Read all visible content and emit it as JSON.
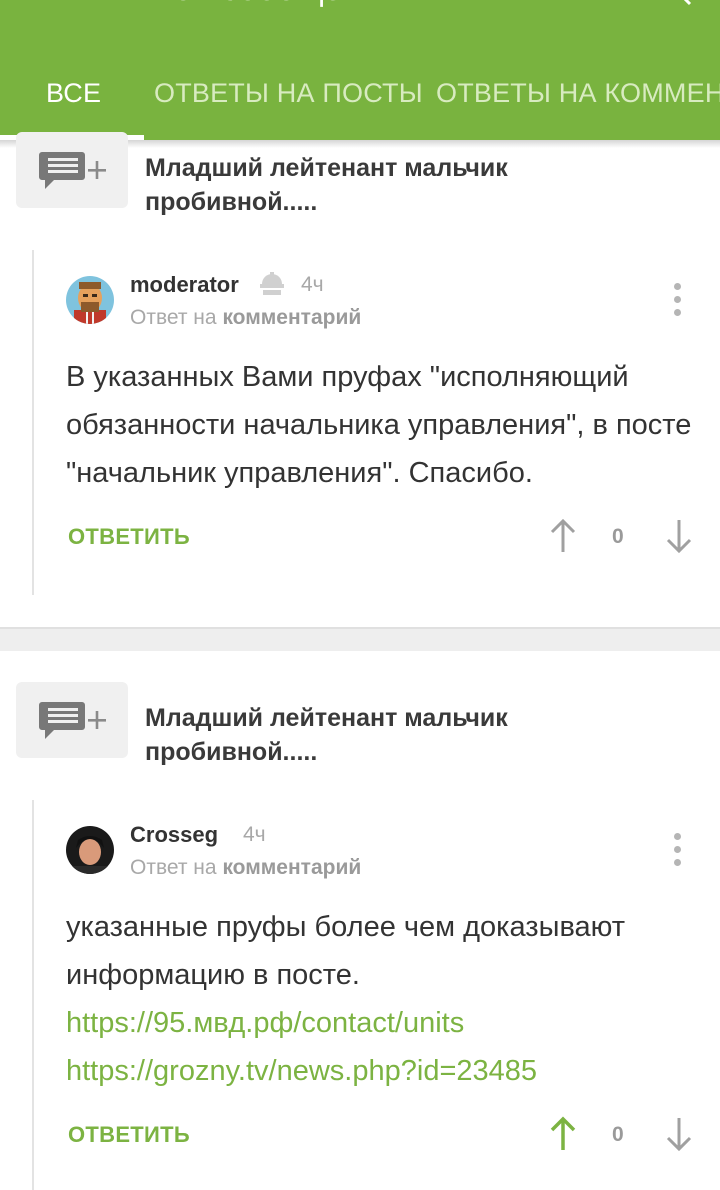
{
  "appbar": {
    "title": "Мои сообщения",
    "search_icon": "search-icon"
  },
  "tabs": [
    {
      "label": "ВСЕ",
      "active": true
    },
    {
      "label": "ОТВЕТЫ НА ПОСТЫ",
      "active": false
    },
    {
      "label": "ОТВЕТЫ НА КОММЕН",
      "active": false
    }
  ],
  "colors": {
    "accent": "#79b33f",
    "link": "#7cb342",
    "upvote_active": "#7cb342",
    "vote_inactive": "#a0a0a0"
  },
  "threads": [
    {
      "post_title": "Младший лейтенант мальчик пробивной.....",
      "comment": {
        "username": "moderator",
        "time": "4ч",
        "reply_prefix": "Ответ на",
        "reply_target": "комментарий",
        "text": "В указанных Вами пруфах \"исполняющий обязанности начальника управления\", в посте \"начальник  управления\". Спасибо.",
        "links": [],
        "reply_label": "ОТВЕТИТЬ",
        "score": "0"
      }
    },
    {
      "post_title": "Младший лейтенант мальчик пробивной.....",
      "comment": {
        "username": "Crosseg",
        "time": "4ч",
        "reply_prefix": "Ответ на",
        "reply_target": "комментарий",
        "text": "указанные пруфы более чем доказывают информацию в посте.",
        "links": [
          "https://95.мвд.рф/contact/units",
          "https://grozny.tv/news.php?id=23485"
        ],
        "reply_label": "ОТВЕТИТЬ",
        "score": "0"
      }
    }
  ]
}
